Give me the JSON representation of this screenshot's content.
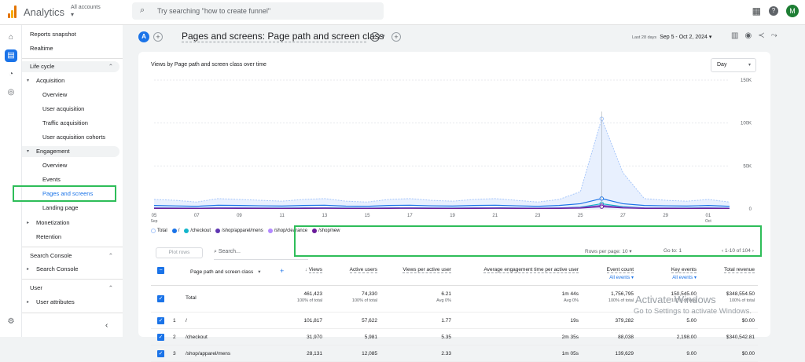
{
  "topbar": {
    "app_title": "Analytics",
    "account_label": "All accounts",
    "search_placeholder": "Try searching \"how to create funnel\"",
    "avatar_letter": "M"
  },
  "nav": {
    "reports_snapshot": "Reports snapshot",
    "realtime": "Realtime",
    "lifecycle": "Life cycle",
    "acquisition": "Acquisition",
    "acq_items": [
      "Overview",
      "User acquisition",
      "Traffic acquisition",
      "User acquisition cohorts"
    ],
    "engagement": "Engagement",
    "eng_items": [
      "Overview",
      "Events",
      "Pages and screens",
      "Landing page"
    ],
    "monetization": "Monetization",
    "retention": "Retention",
    "search_console_section": "Search Console",
    "search_console_item": "Search Console",
    "user_section": "User",
    "user_attributes": "User attributes"
  },
  "page": {
    "badge": "A",
    "title": "Pages and screens: Page path and screen class",
    "date_prefix": "Last 28 days",
    "date_range": "Sep 5 - Oct 2, 2024"
  },
  "chart_header": {
    "title": "Views by Page path and screen class over time",
    "granularity": "Day"
  },
  "chart_data": {
    "type": "line",
    "x": [
      "Sep 5",
      "Sep 6",
      "Sep 7",
      "Sep 8",
      "Sep 9",
      "Sep 10",
      "Sep 11",
      "Sep 12",
      "Sep 13",
      "Sep 14",
      "Sep 15",
      "Sep 16",
      "Sep 17",
      "Sep 18",
      "Sep 19",
      "Sep 20",
      "Sep 21",
      "Sep 22",
      "Sep 23",
      "Sep 24",
      "Sep 25",
      "Sep 26",
      "Sep 27",
      "Sep 28",
      "Sep 29",
      "Sep 30",
      "Oct 1",
      "Oct 2"
    ],
    "x_tick_labels": [
      "05",
      "07",
      "09",
      "11",
      "13",
      "15",
      "17",
      "19",
      "21",
      "23",
      "25",
      "27",
      "29",
      "01"
    ],
    "x_tick_sublabels": {
      "05": "Sep",
      "01": "Oct"
    },
    "y_tick_labels": [
      "150K",
      "100K",
      "50K",
      "0"
    ],
    "ylim": [
      0,
      150000
    ],
    "series": [
      {
        "name": "Total",
        "color": "#a8c7fa",
        "values": [
          11000,
          10000,
          8000,
          12000,
          11000,
          10000,
          9000,
          11000,
          12000,
          9000,
          8000,
          11000,
          12000,
          10000,
          9000,
          11000,
          12000,
          10000,
          8000,
          11000,
          20000,
          105000,
          42000,
          12000,
          10000,
          9000,
          11000,
          8000
        ]
      },
      {
        "name": "/",
        "color": "#1a73e8",
        "values": [
          4000,
          3500,
          3000,
          4200,
          4000,
          3600,
          3300,
          4000,
          4300,
          3200,
          3000,
          4000,
          4300,
          3600,
          3300,
          4000,
          4300,
          3600,
          3000,
          4000,
          6000,
          12000,
          6000,
          4000,
          3600,
          3300,
          4000,
          3000
        ]
      },
      {
        "name": "/checkout",
        "color": "#12b5cb",
        "values": [
          1200,
          1100,
          900,
          1300,
          1200,
          1100,
          1000,
          1200,
          1300,
          1000,
          900,
          1200,
          1300,
          1100,
          1000,
          1200,
          1300,
          1100,
          900,
          1200,
          2000,
          6000,
          2500,
          1200,
          1100,
          1000,
          1200,
          900
        ]
      },
      {
        "name": "/shop/apparel/mens",
        "color": "#5e35b1",
        "values": [
          1000,
          900,
          800,
          1100,
          1000,
          950,
          850,
          1000,
          1100,
          850,
          800,
          1000,
          1100,
          950,
          850,
          1000,
          1100,
          950,
          800,
          1000,
          1600,
          4000,
          1800,
          1000,
          950,
          850,
          1000,
          800
        ]
      },
      {
        "name": "/shop/clearance",
        "color": "#b388ff",
        "values": [
          800,
          700,
          600,
          900,
          800,
          750,
          650,
          800,
          900,
          650,
          600,
          800,
          900,
          750,
          650,
          800,
          900,
          750,
          600,
          800,
          1200,
          3000,
          1400,
          800,
          750,
          650,
          800,
          600
        ]
      },
      {
        "name": "/shop/new",
        "color": "#6a1b9a",
        "values": [
          600,
          550,
          500,
          700,
          600,
          580,
          520,
          600,
          700,
          520,
          500,
          600,
          700,
          580,
          520,
          600,
          700,
          580,
          500,
          600,
          900,
          2500,
          1100,
          600,
          580,
          520,
          600,
          500
        ]
      }
    ]
  },
  "table_toolbar": {
    "plot_rows": "Plot rows",
    "search": "Search...",
    "rows_per_page_label": "Rows per page:",
    "rows_per_page": "10",
    "goto_label": "Go to:",
    "goto_value": "1",
    "pager": "1-10 of 104"
  },
  "table": {
    "dimension_header": "Page path and screen class",
    "columns": [
      {
        "label": "Views",
        "sub": ""
      },
      {
        "label": "Active users",
        "sub": ""
      },
      {
        "label": "Views per active user",
        "sub": ""
      },
      {
        "label": "Average engagement time per active user",
        "sub": ""
      },
      {
        "label": "Event count",
        "sub": "All events"
      },
      {
        "label": "Key events",
        "sub": "All events"
      },
      {
        "label": "Total revenue",
        "sub": ""
      }
    ],
    "total": {
      "label": "Total",
      "values": [
        "461,423",
        "74,330",
        "6.21",
        "1m 44s",
        "1,756,795",
        "150,545.00",
        "$348,554.50"
      ],
      "subs": [
        "100% of total",
        "100% of total",
        "Avg 0%",
        "Avg 0%",
        "100% of total",
        "100% of total",
        "100% of total"
      ]
    },
    "rows": [
      {
        "n": "1",
        "dim": "/",
        "values": [
          "101,817",
          "57,622",
          "1.77",
          "19s",
          "379,282",
          "5.00",
          "$0.00"
        ]
      },
      {
        "n": "2",
        "dim": "/checkout",
        "values": [
          "31,970",
          "5,981",
          "5.35",
          "2m 35s",
          "88,038",
          "2,198.00",
          "$340,542.81"
        ]
      },
      {
        "n": "3",
        "dim": "/shop/apparel/mens",
        "values": [
          "28,131",
          "12,085",
          "2.33",
          "1m 05s",
          "139,629",
          "9.00",
          "$0.00"
        ]
      }
    ]
  },
  "watermark": {
    "line1": "Activate Windows",
    "line2": "Go to Settings to activate Windows."
  }
}
